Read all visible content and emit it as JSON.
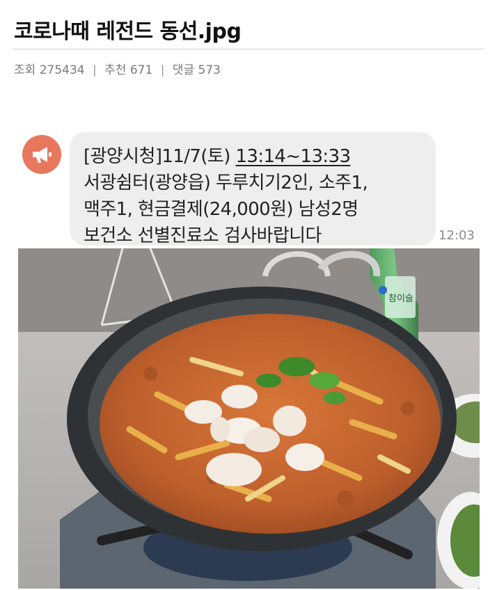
{
  "post": {
    "title": "코로나때 레전드 동선.jpg",
    "views_label": "조회",
    "views": "275434",
    "recommend_label": "추천",
    "recommend": "671",
    "comments_label": "댓글",
    "comments": "573",
    "separator": "|"
  },
  "alert": {
    "line1_prefix": "[광양시청]11/7(토) ",
    "line1_time": "13:14~13:33",
    "line2": "서광쉼터(광양읍) 두루치기2인, 소주1,",
    "line3": "맥주1, 현금결제(24,000원) 남성2명",
    "line4": "보건소 선별진료소 검사바랍니다",
    "time": "12:03",
    "icon": "megaphone-icon"
  },
  "photo": {
    "bottle_label": "참이슬",
    "colors": {
      "table": "#b9b9b9",
      "pan": "#3a3a3a",
      "stew": "#c8662e"
    }
  }
}
